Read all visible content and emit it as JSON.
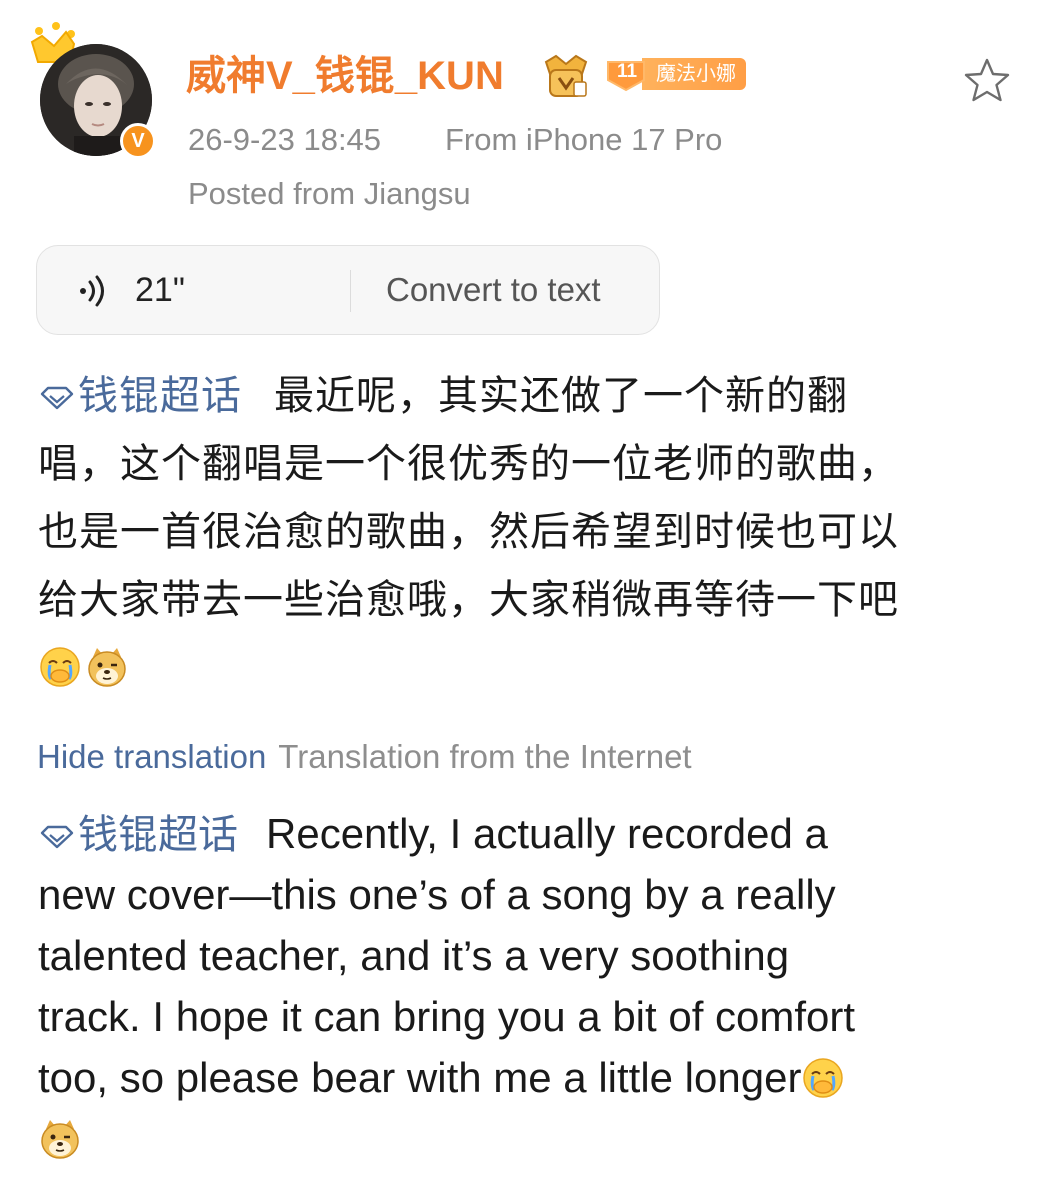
{
  "user": {
    "name": "威神V_钱锟_KUN",
    "fan_badge_level": "11",
    "fan_badge_label": "魔法小娜"
  },
  "meta": {
    "timestamp": "26-9-23 18:45",
    "source": "From iPhone 17 Pro",
    "location": "Posted from Jiangsu"
  },
  "voice": {
    "duration": "21\"",
    "convert_label": "Convert to text"
  },
  "post": {
    "topic": "钱锟超话",
    "lines": [
      "最近呢，其实还做了一个新的翻",
      "唱，这个翻唱是一个很优秀的一位老师的歌曲，",
      "也是一首很治愈的歌曲，然后希望到时候也可以",
      "给大家带去一些治愈哦，大家稍微再等待一下吧"
    ]
  },
  "translation": {
    "hide_label": "Hide translation",
    "source_label": "Translation from the Internet",
    "topic": "钱锟超话",
    "lines": [
      "Recently, I actually recorded a",
      "new cover—this one’s of a song by a really",
      "talented teacher, and it’s a very soothing",
      "track. I hope it can bring you a bit of comfort",
      "too, so please bear with me a little longer"
    ]
  },
  "colors": {
    "username": "#f07c2e",
    "link": "#4a6a9b",
    "meta": "#8b8b8b",
    "badge_orange": "#f7931e"
  },
  "icons": {
    "crown": "crown-icon",
    "verified": "verified-icon",
    "rank_badge": "rank-badge-icon",
    "star": "star-icon",
    "voice": "voice-wave-icon",
    "topic": "diamond-topic-icon",
    "emoji_1": "crying-face-emoji",
    "emoji_2": "doge-emoji"
  }
}
